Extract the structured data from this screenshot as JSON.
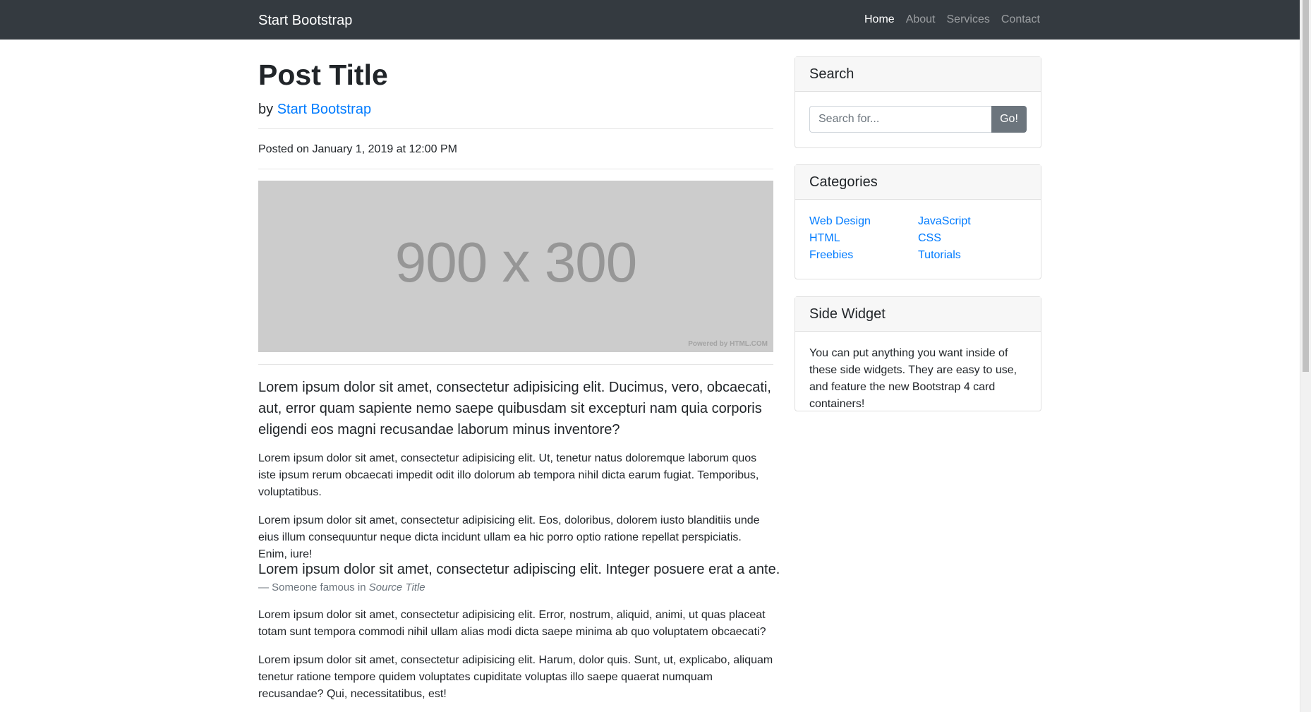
{
  "navbar": {
    "brand": "Start Bootstrap",
    "links": [
      "Home",
      "About",
      "Services",
      "Contact"
    ]
  },
  "post": {
    "title": "Post Title",
    "by": "by",
    "author": "Start Bootstrap",
    "posted": "Posted on January 1, 2019 at 12:00 PM",
    "image_text": "900 x 300",
    "image_credit": "Powered by HTML.COM",
    "lead": "Lorem ipsum dolor sit amet, consectetur adipisicing elit. Ducimus, vero, obcaecati, aut, error quam sapiente nemo saepe quibusdam sit excepturi nam quia corporis eligendi eos magni recusandae laborum minus inventore?",
    "para1": "Lorem ipsum dolor sit amet, consectetur adipisicing elit. Ut, tenetur natus doloremque laborum quos iste ipsum rerum obcaecati impedit odit illo dolorum ab tempora nihil dicta earum fugiat. Temporibus, voluptatibus.",
    "para2": "Lorem ipsum dolor sit amet, consectetur adipisicing elit. Eos, doloribus, dolorem iusto blanditiis unde eius illum consequuntur neque dicta incidunt ullam ea hic porro optio ratione repellat perspiciatis. Enim, iure!",
    "quote": "Lorem ipsum dolor sit amet, consectetur adipiscing elit. Integer posuere erat a ante.",
    "quote_source_prefix": "— Someone famous in",
    "quote_source_title": "Source Title",
    "para3": "Lorem ipsum dolor sit amet, consectetur adipisicing elit. Error, nostrum, aliquid, animi, ut quas placeat totam sunt tempora commodi nihil ullam alias modi dicta saepe minima ab quo voluptatem obcaecati?",
    "para4": "Lorem ipsum dolor sit amet, consectetur adipisicing elit. Harum, dolor quis. Sunt, ut, explicabo, aliquam tenetur ratione tempore quidem voluptates cupiditate voluptas illo saepe quaerat numquam recusandae? Qui, necessitatibus, est!"
  },
  "search": {
    "title": "Search",
    "placeholder": "Search for...",
    "button": "Go!"
  },
  "categories": {
    "title": "Categories",
    "left": [
      "Web Design",
      "HTML",
      "Freebies"
    ],
    "right": [
      "JavaScript",
      "CSS",
      "Tutorials"
    ]
  },
  "side_widget": {
    "title": "Side Widget",
    "text": "You can put anything you want inside of these side widgets. They are easy to use, and feature the new Bootstrap 4 card containers!"
  },
  "colors": {
    "navbar": "#343a40",
    "link": "#007bff",
    "button": "#6c757d"
  }
}
